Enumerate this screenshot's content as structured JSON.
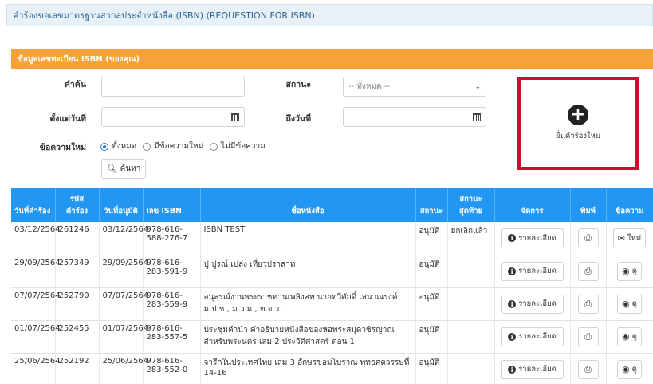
{
  "header": {
    "title": "คำร้องขอเลขมาตรฐานสากลประจำหนังสือ (ISBN) (REQUESTION FOR ISBN)"
  },
  "panel": {
    "title": "ข้อมูลเลขทะเบียน ISBN (ของคุณ)"
  },
  "filters": {
    "keyword_label": "คำค้น",
    "keyword_value": "",
    "status_label": "สถานะ",
    "status_selected": "-- ทั้งหมด --",
    "from_label": "ตั้งแต่วันที่",
    "to_label": "ถึงวันที่",
    "new_message_label": "ข้อความใหม่",
    "radio_options": [
      "ทั้งหมด",
      "มีข้อความใหม่",
      "ไม่มีข้อความ"
    ],
    "radio_selected": 0,
    "search_button": "ค้นหา"
  },
  "new_request": {
    "label": "ยื่นคำร้องใหม่"
  },
  "table": {
    "columns": [
      "วันที่คำร้อง",
      "รหัส คำร้อง",
      "วันที่อนุมัติ",
      "เลข ISBN",
      "ชื่อหนังสือ",
      "สถานะ",
      "สถานะ สุดท้าย",
      "จัดการ",
      "พิมพ์",
      "ข้อความ"
    ],
    "rows": [
      {
        "date": "03/12/2564",
        "code": "261246",
        "approved": "03/12/2564",
        "isbn": "978-616-588-276-7",
        "title": "ISBN TEST",
        "status": "อนุมัติ",
        "final": "ยกเลิกแล้ว",
        "detail": "รายละเอียด",
        "msg": "ใหม่"
      },
      {
        "date": "29/09/2564",
        "code": "257349",
        "approved": "29/09/2564",
        "isbn": "978-616-283-591-9",
        "title": "ปู่ ปูรณ์ เปล่ง เที่ยวปราสาท",
        "status": "อนุมัติ",
        "final": "",
        "detail": "รายละเอียด",
        "msg": "ดู"
      },
      {
        "date": "07/07/2564",
        "code": "252790",
        "approved": "07/07/2564",
        "isbn": "978-616-283-559-9",
        "title": "อนุสรณ์งานพระราชทานเพลิงศพ นายทวีศักดิ์ เสนาณรงค์ ม.ป.ช., ม.ว.ม., ท.จ.ว.",
        "status": "อนุมัติ",
        "final": "",
        "detail": "รายละเอียด",
        "msg": "ดู"
      },
      {
        "date": "01/07/2564",
        "code": "252455",
        "approved": "01/07/2564",
        "isbn": "978-616-283-557-5",
        "title": "ประชุมคำนำ คำอธิบายหนังสือของหอพระสมุดวชิรญาณ สำหรับพระนคร เล่ม 2 ประวัติศาสตร์ ตอน 1",
        "status": "อนุมัติ",
        "final": "",
        "detail": "รายละเอียด",
        "msg": "ดู"
      },
      {
        "date": "25/06/2564",
        "code": "252192",
        "approved": "25/06/2564",
        "isbn": "978-616-283-552-0",
        "title": "จารึกในประเทศไทย เล่ม 3 อักษรขอมโบราณ พุทธศตวรรษที่ 14-16",
        "status": "อนุมัติ",
        "final": "",
        "detail": "รายละเอียด",
        "msg": "ดู"
      }
    ]
  }
}
